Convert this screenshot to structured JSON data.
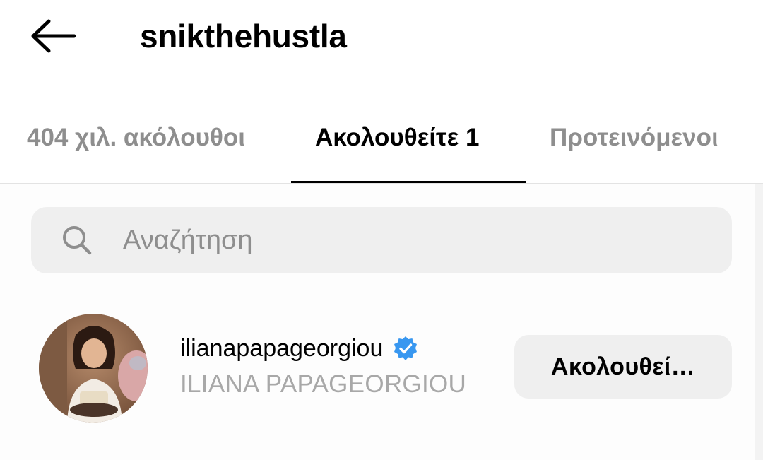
{
  "header": {
    "back_icon": "arrow-left-icon",
    "title": "snikthehustla"
  },
  "tabs": [
    {
      "label": "404 χιλ. ακόλουθοι",
      "active": false
    },
    {
      "label": "Ακολουθείτε 1",
      "active": true
    },
    {
      "label": "Προτεινόμενοι",
      "active": false
    }
  ],
  "search": {
    "icon": "search-icon",
    "placeholder": "Αναζήτηση",
    "value": ""
  },
  "users": [
    {
      "username": "ilianapapageorgiou",
      "verified": true,
      "full_name": "ILIANA PAPAGEORGIOU",
      "button_label": "Ακολουθεί…",
      "avatar_icon": "profile-photo"
    }
  ],
  "colors": {
    "accent_verified": "#3897f0",
    "muted_text": "#8e8e8e",
    "button_bg": "#efefef",
    "active_tab_underline": "#000000"
  }
}
